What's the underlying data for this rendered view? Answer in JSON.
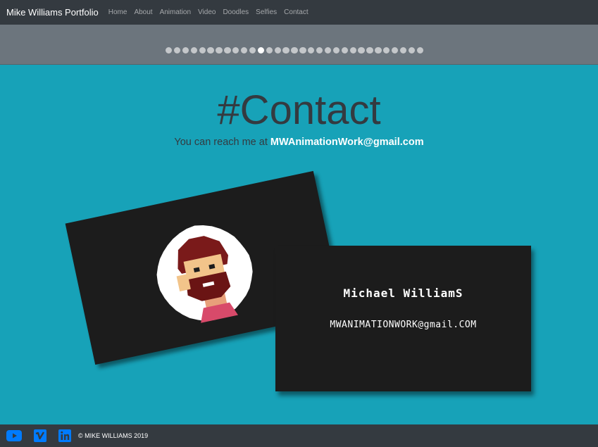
{
  "navbar": {
    "brand": "Mike Williams Portfolio",
    "links": [
      "Home",
      "About",
      "Animation",
      "Video",
      "Doodles",
      "Selfies",
      "Contact"
    ]
  },
  "carousel": {
    "total_slides": 31,
    "active_index": 11
  },
  "hero": {
    "title": "#Contact",
    "subtitle_prefix": "You can reach me at",
    "email": "MWAnimationWork@gmail.com"
  },
  "business_card": {
    "name": "Michael WilliamS",
    "email": "MWANIMATIONWORK@gmail.COM"
  },
  "footer": {
    "social_icons": [
      "youtube-icon",
      "vimeo-icon",
      "linkedin-icon"
    ],
    "copyright": "© MIKE WILLIAMS 2019"
  },
  "colors": {
    "navbar_bg": "#343a40",
    "band_bg": "#6c757d",
    "page_bg": "#17a2b8",
    "card_bg": "#1c1c1c",
    "icon_blue": "#007bff"
  }
}
